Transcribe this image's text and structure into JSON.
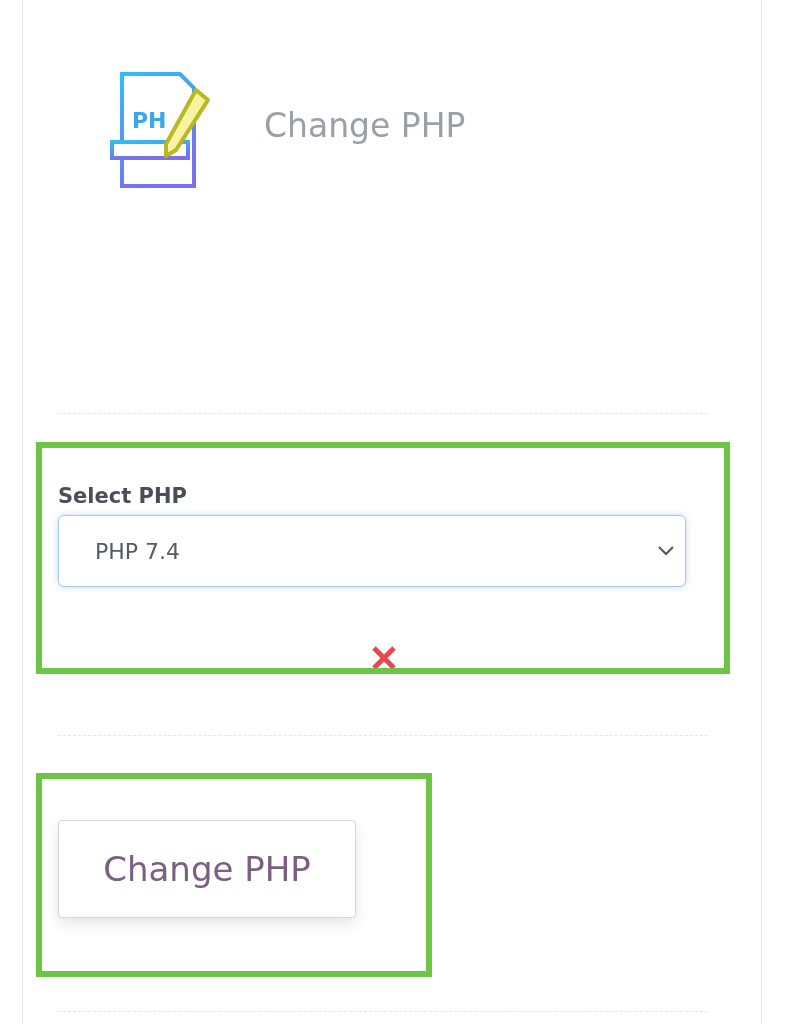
{
  "header": {
    "icon_text": "PH",
    "title": "Change PHP"
  },
  "php_select": {
    "label": "Select PHP",
    "value": "PHP 7.4",
    "highlighted": true
  },
  "submit": {
    "label": "Change PHP",
    "highlighted": true
  }
}
